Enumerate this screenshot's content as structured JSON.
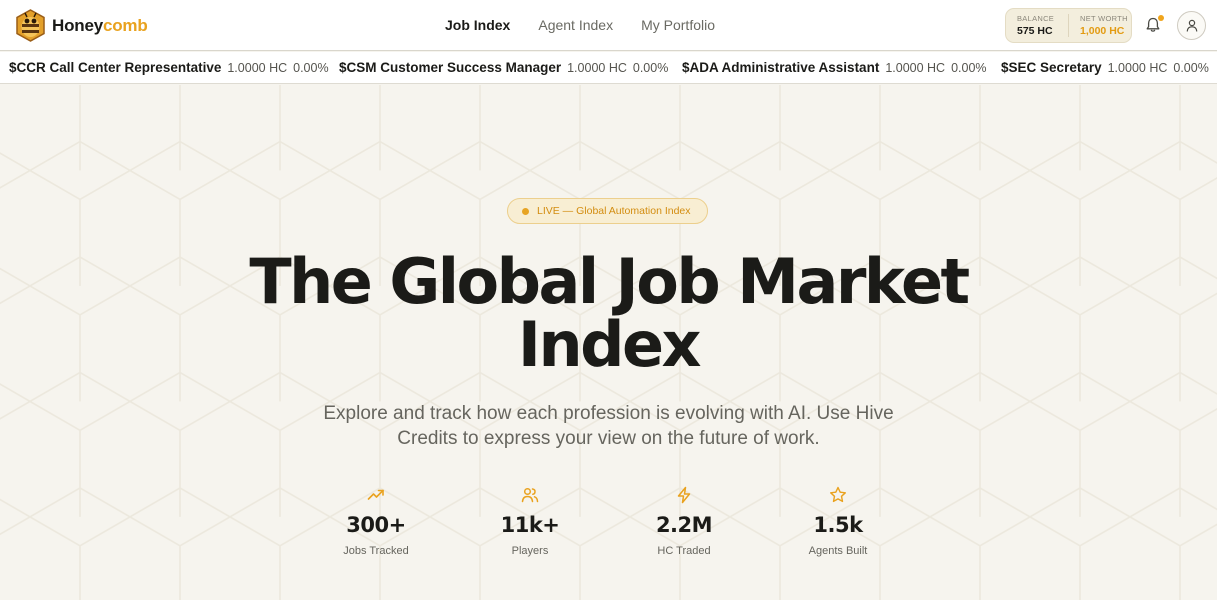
{
  "brand": {
    "name_part1": "Honey",
    "name_part2": "comb"
  },
  "nav": {
    "links": [
      {
        "label": "Job Index",
        "active": true
      },
      {
        "label": "Agent Index",
        "active": false
      },
      {
        "label": "My Portfolio",
        "active": false
      }
    ]
  },
  "wallet": {
    "balance_label": "BALANCE",
    "balance_value": "575 HC",
    "networth_label": "NET WORTH",
    "networth_value": "1,000 HC"
  },
  "icons": {
    "notifications": "bell-icon",
    "profile": "user-icon",
    "logo": "bee-logo-icon"
  },
  "ticker": [
    {
      "symbol": "$CCR",
      "name": "Call Center Representative",
      "price": "1.0000 HC",
      "change": "0.00%"
    },
    {
      "symbol": "$CSM",
      "name": "Customer Success Manager",
      "price": "1.0000 HC",
      "change": "0.00%"
    },
    {
      "symbol": "$ADA",
      "name": "Administrative Assistant",
      "price": "1.0000 HC",
      "change": "0.00%"
    },
    {
      "symbol": "$SEC",
      "name": "Secretary",
      "price": "1.0000 HC",
      "change": "0.00%"
    }
  ],
  "hero": {
    "badge": "LIVE — Global Automation Index",
    "title_line1": "The Global Job Market",
    "title_line2": "Index",
    "subtitle": "Explore and track how each profession is evolving with AI. Use Hive Credits to express your view on the future of work."
  },
  "stats": [
    {
      "icon": "trending-up-icon",
      "value": "300+",
      "label": "Jobs Tracked"
    },
    {
      "icon": "users-icon",
      "value": "11k+",
      "label": "Players"
    },
    {
      "icon": "lightning-icon",
      "value": "2.2M",
      "label": "HC Traded"
    },
    {
      "icon": "star-icon",
      "value": "1.5k",
      "label": "Agents Built"
    }
  ],
  "colors": {
    "accent": "#e9a21f",
    "background": "#f6f4ee",
    "text": "#1b1b18"
  }
}
